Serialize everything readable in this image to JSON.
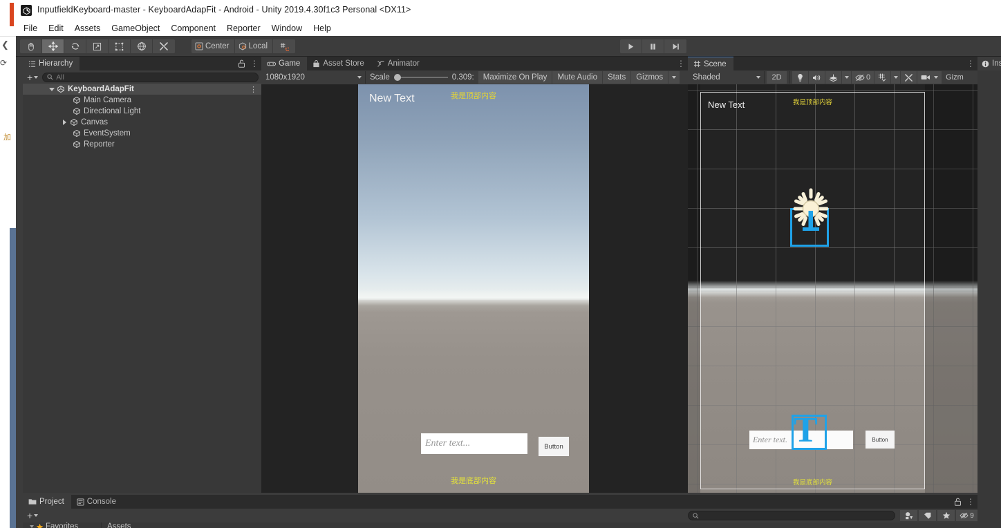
{
  "window": {
    "title": "InputfieldKeyboard-master - KeyboardAdapFit - Android - Unity 2019.4.30f1c3 Personal <DX11>",
    "app_icon": "unity-icon"
  },
  "menubar": {
    "items": [
      "File",
      "Edit",
      "Assets",
      "GameObject",
      "Component",
      "Reporter",
      "Window",
      "Help"
    ]
  },
  "toolbar": {
    "tools": [
      {
        "name": "hand-tool",
        "icon": "hand-icon",
        "active": false
      },
      {
        "name": "move-tool",
        "icon": "move-icon",
        "active": true
      },
      {
        "name": "rotate-tool",
        "icon": "rotate-icon",
        "active": false
      },
      {
        "name": "scale-tool",
        "icon": "scale-icon",
        "active": false
      },
      {
        "name": "rect-tool",
        "icon": "rect-icon",
        "active": false
      },
      {
        "name": "transform-tool",
        "icon": "transform-icon",
        "active": false
      },
      {
        "name": "custom-tool",
        "icon": "wrench-icon",
        "active": false
      }
    ],
    "pivot_label": "Center",
    "space_label": "Local",
    "snap_label": "",
    "play_label": "play-icon",
    "pause_label": "pause-icon",
    "step_label": "step-icon"
  },
  "hierarchy": {
    "tab_label": "Hierarchy",
    "tab_icon": "hierarchy-icon",
    "lock_icon": "lock-open-icon",
    "menu_icon": "kebab-icon",
    "add_label": "+",
    "search_placeholder": "All",
    "items": [
      {
        "label": "KeyboardAdapFit",
        "depth": 0,
        "foldout": "open",
        "selected": true,
        "icon": "scene-icon"
      },
      {
        "label": "Main Camera",
        "depth": 1,
        "foldout": "none",
        "selected": false,
        "icon": "gameobject-icon"
      },
      {
        "label": "Directional Light",
        "depth": 1,
        "foldout": "none",
        "selected": false,
        "icon": "gameobject-icon"
      },
      {
        "label": "Canvas",
        "depth": 1,
        "foldout": "closed",
        "selected": false,
        "icon": "gameobject-icon"
      },
      {
        "label": "EventSystem",
        "depth": 1,
        "foldout": "none",
        "selected": false,
        "icon": "gameobject-icon"
      },
      {
        "label": "Reporter",
        "depth": 1,
        "foldout": "none",
        "selected": false,
        "icon": "gameobject-icon"
      }
    ]
  },
  "game_panel": {
    "tabs": [
      {
        "label": "Game",
        "icon": "game-icon",
        "active": true
      },
      {
        "label": "Asset Store",
        "icon": "store-icon",
        "active": false
      },
      {
        "label": "Animator",
        "icon": "animator-icon",
        "active": false
      }
    ],
    "menu_icon": "kebab-icon",
    "resolution": "1080x1920",
    "scale_label": "Scale",
    "scale_value": "0.309:",
    "maximize_label": "Maximize On Play",
    "mute_label": "Mute Audio",
    "stats_label": "Stats",
    "gizmos_label": "Gizmos",
    "content": {
      "new_text": "New Text",
      "top_text": "我是顶部内容",
      "bottom_text": "我是底部内容",
      "input_placeholder": "Enter text...",
      "button_label": "Button"
    }
  },
  "scene_panel": {
    "tabs": [
      {
        "label": "Scene",
        "icon": "scene-grid-icon",
        "active": true
      }
    ],
    "menu_icon": "kebab-icon",
    "draw_mode": "Shaded",
    "mode_2d": "2D",
    "lighting_icon": "lightbulb-icon",
    "audio_icon": "speaker-icon",
    "fx_icon": "fx-icon",
    "hidden_count": "0",
    "hidden_icon": "eye-off-icon",
    "grid_icon": "grid-icon",
    "tools_icon": "wrench-icon",
    "camera_icon": "camera-icon",
    "gizmos_label": "Gizm",
    "content": {
      "new_text": "New Text",
      "top_text": "我是顶部内容",
      "bottom_text": "我是底部内容",
      "input_placeholder": "Enter text.",
      "button_label": "Button",
      "light_gizmo": "directional-light-gizmo",
      "text_gizmo": "T"
    }
  },
  "inspector": {
    "tab_label": "Inspec",
    "tab_icon": "info-icon"
  },
  "project_panel": {
    "tabs": [
      {
        "label": "Project",
        "icon": "folder-icon",
        "active": true
      },
      {
        "label": "Console",
        "icon": "console-icon",
        "active": false
      }
    ],
    "lock_icon": "lock-open-icon",
    "menu_icon": "kebab-icon",
    "add_label": "+",
    "search_placeholder": "",
    "search_icon": "search-icon",
    "filter_icons": [
      "object-filter-icon",
      "label-filter-icon",
      "favorite-filter-icon"
    ],
    "hidden_count": "9",
    "hidden_icon": "eye-off-icon",
    "favorites_label": "Favorites",
    "assets_label": "Assets"
  },
  "colors": {
    "accent_blue": "#1fa2e8",
    "tab_highlight": "#4a7fc1",
    "panel_bg": "#383838",
    "toolbar_bg": "#3c3c3c",
    "tabs_bg": "#2b2b2b",
    "ui_yellow": "#e2d23a",
    "favorite_star": "#f0a81e"
  }
}
